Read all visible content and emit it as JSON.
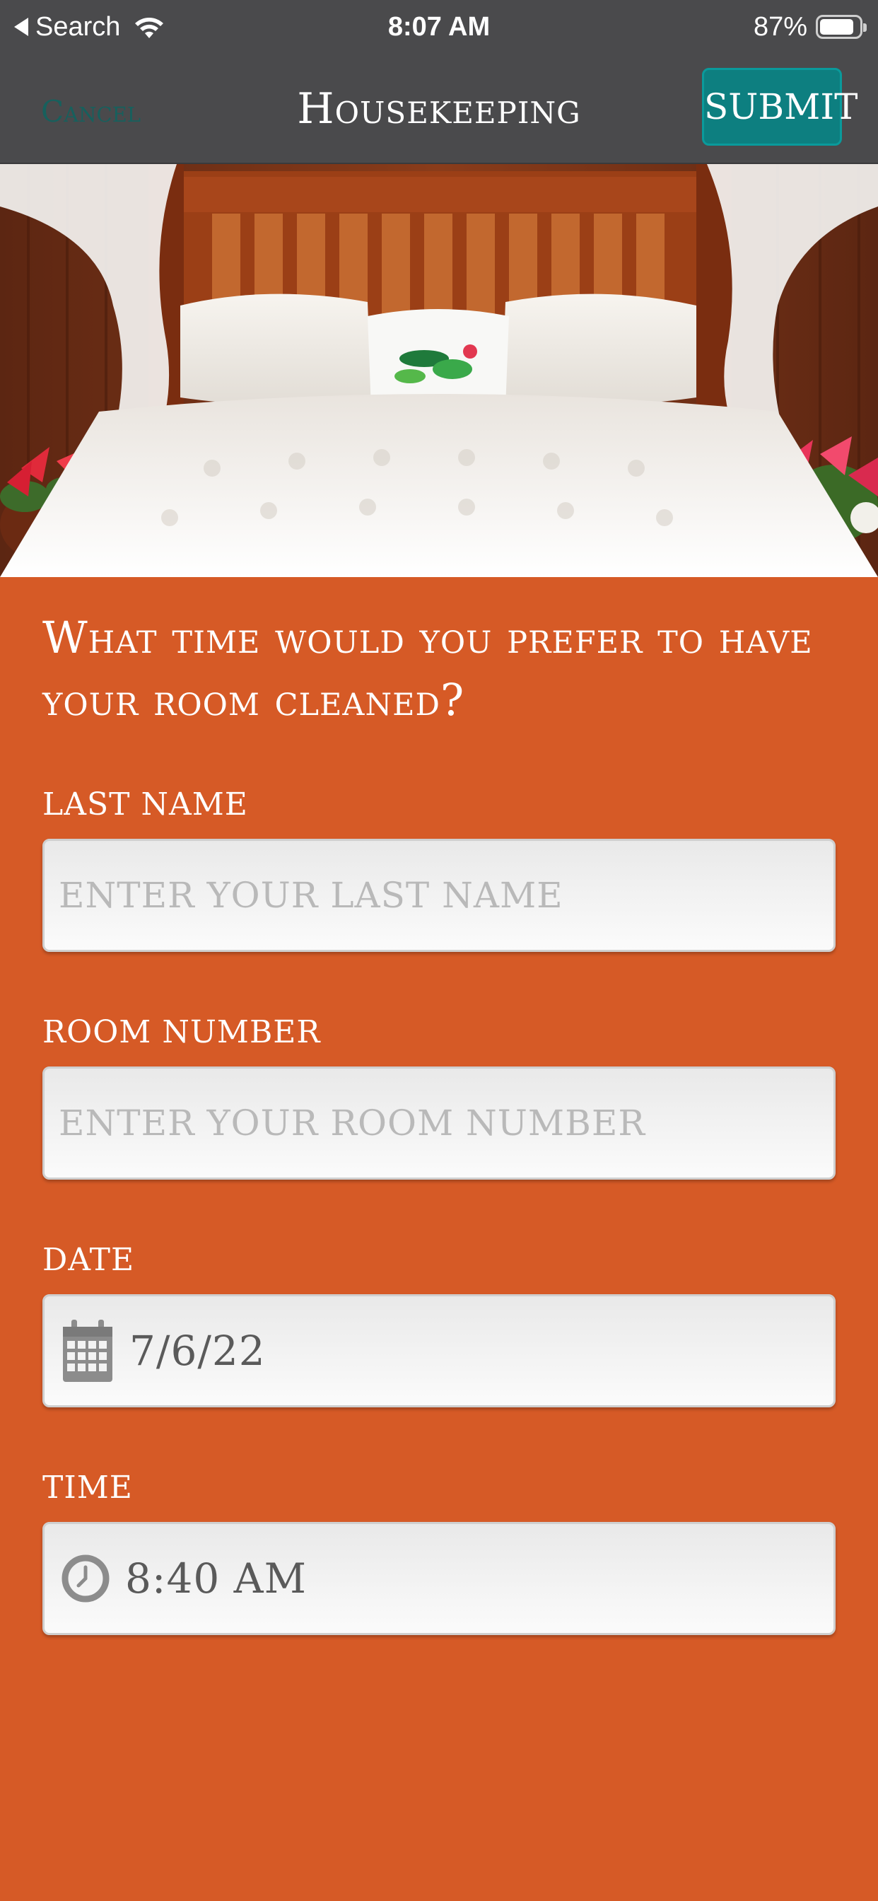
{
  "status_bar": {
    "back_label": "Search",
    "time": "8:07 AM",
    "battery_percent": "87%",
    "battery_level": 0.87
  },
  "nav": {
    "cancel_label": "Cancel",
    "title": "Housekeeping",
    "submit_label": "SUBMIT"
  },
  "form": {
    "question": "What time would you prefer to have your room cleaned?",
    "last_name": {
      "label": "LAST NAME",
      "placeholder": "ENTER YOUR LAST NAME",
      "value": ""
    },
    "room_number": {
      "label": "ROOM NUMBER",
      "placeholder": "ENTER YOUR ROOM NUMBER",
      "value": ""
    },
    "date": {
      "label": "DATE",
      "value": "7/6/22",
      "icon": "calendar-icon"
    },
    "time": {
      "label": "TIME",
      "value": "8:40 AM",
      "icon": "clock-icon"
    }
  },
  "colors": {
    "background": "#d65a26",
    "bar": "#4a4a4c",
    "submit": "#0d7f80",
    "cancel": "#17605d"
  }
}
